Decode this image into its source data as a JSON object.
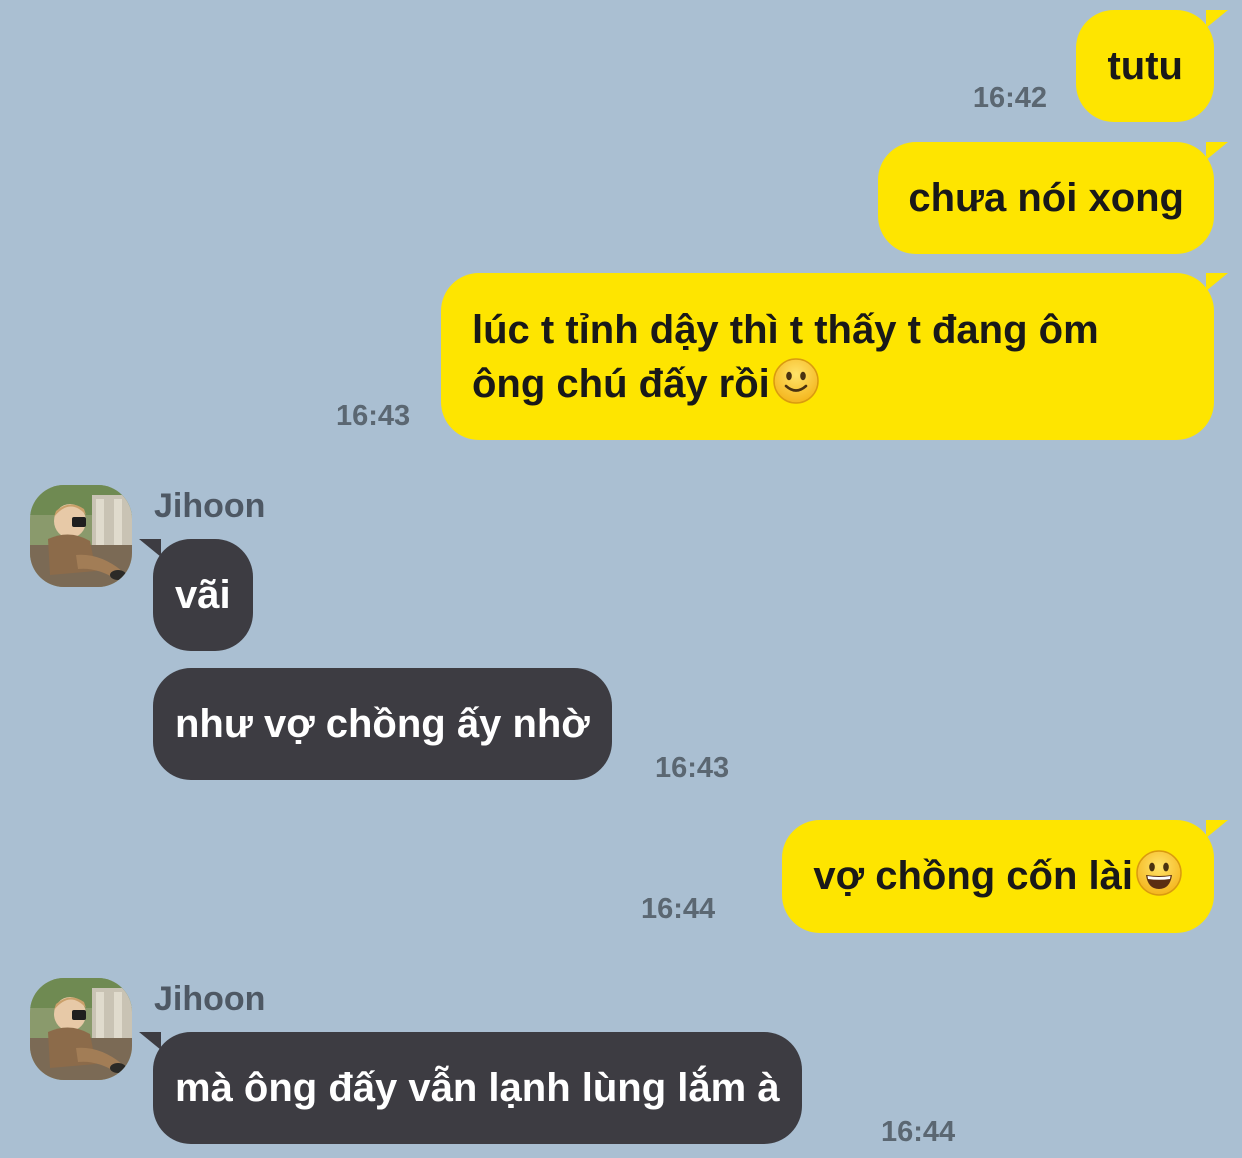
{
  "messages": [
    {
      "text": "tutu",
      "time": "16:42"
    },
    {
      "text": "chưa nói xong"
    },
    {
      "line1": "lúc t tỉnh dậy thì t thấy t đang ôm",
      "line2": "ông chú đấy rồi",
      "emoji": "slightly-smiling-face-icon",
      "time": "16:43"
    },
    {
      "sender": "Jihoon",
      "text": "vãi"
    },
    {
      "text": "như vợ chồng ấy nhờ",
      "time": "16:43"
    },
    {
      "text": "vợ chồng cốn lài",
      "emoji": "grinning-face-icon",
      "time": "16:44"
    },
    {
      "sender": "Jihoon",
      "text": "mà ông đấy vẫn lạnh lùng lắm à",
      "time": "16:44"
    }
  ],
  "colors": {
    "background": "#aabfd2",
    "outgoing_bubble": "#fee500",
    "incoming_bubble": "#3d3c42",
    "timestamp": "#5b6772"
  }
}
